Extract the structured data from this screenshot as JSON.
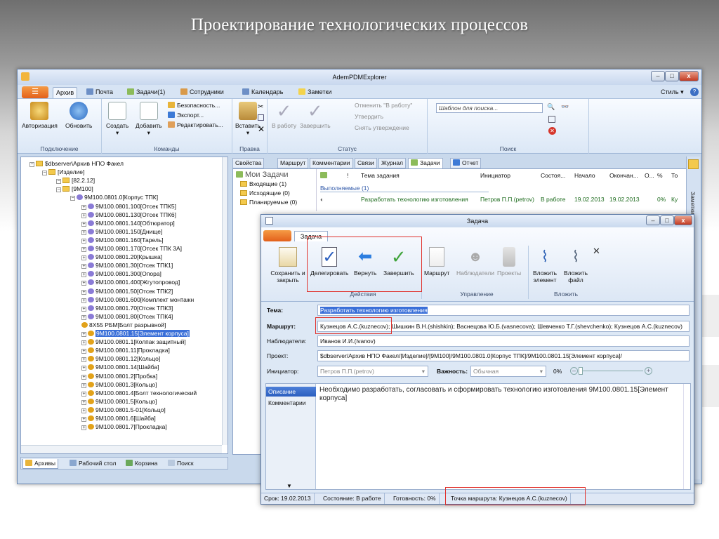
{
  "slide_title": "Проектирование технологических процессов",
  "main_window": {
    "title": "AdemPDMExplorer",
    "menu_tabs": [
      "Архив",
      "Почта",
      "Задачи(1)",
      "Сотрудники",
      "Календарь",
      "Заметки"
    ],
    "style_label": "Стиль",
    "ribbon": {
      "connection": {
        "label": "Подключение",
        "authorize": "Авторизация",
        "refresh": "Обновить"
      },
      "commands": {
        "label": "Команды",
        "create": "Создать",
        "add": "Добавить",
        "security": "Безопасность...",
        "export": "Экспорт...",
        "edit": "Редактировать..."
      },
      "edit": {
        "label": "Правка",
        "paste": "Вставить"
      },
      "status": {
        "label": "Статус",
        "to_work": "В работу",
        "finish": "Завершить",
        "cancel_work": "Отменить \"В работу\"",
        "approve": "Утвердить",
        "remove_approval": "Снять утверждение"
      },
      "search": {
        "label": "Поиск",
        "placeholder": "Шаблон для поиска..."
      }
    }
  },
  "tree": {
    "rows": [
      "$dbserver\\Архив НПО Факел",
      "[Изделие]",
      "[82.2.12]",
      "[9М100]",
      "9М100.0801.0[Корпус ТПК]",
      "9М100.0801.100[Отсек ТПК5]",
      "9М100.0801.130[Отсек ТПК6]",
      "9М100.0801.140[Обтюратор]",
      "9М100.0801.150[Днище]",
      "9М100.0801.160[Тарель]",
      "9М100.0801.170[Отсек ТПК 3А]",
      "9М100.0801.20[Крышка]",
      "9М100.0801.30[Отсек ТПК1]",
      "9М100.0801.300[Опора]",
      "9М100.0801.400[Жгутопровод]",
      "9М100.0801.50[Отсек ТПК2]",
      "9М100.0801.600[Комплект монтажн",
      "9М100.0801.70[Отсек ТПК3]",
      "9М100.0801.80[Отсек ТПК4]",
      "8Х55 РБМ[Болт разрывной]",
      "9М100.0801.15[Элемент корпуса]",
      "9М100.0801.1[Колпак защитный]",
      "9М100.0801.11[Прокладка]",
      "9М100.0801.12[Кольцо]",
      "9М100.0801.14[Шайба]",
      "9М100.0801.2[Пробка]",
      "9М100.0801.3[Кольцо]",
      "9М100.0801.4[Болт технологический",
      "9М100.0801.5[Кольцо]",
      "9М100.0801.5-01[Кольцо]",
      "9М100.0801.6[Шайба]",
      "9М100.0801.7[Прокладка]"
    ]
  },
  "bottom_tabs": [
    "Архивы",
    "Рабочий стол",
    "Корзина",
    "Поиск"
  ],
  "doc_tabs": [
    "Свойства",
    "Маршрут",
    "Комментарии",
    "Связи",
    "Журнал",
    "Задачи",
    "Отчет"
  ],
  "my_tasks": {
    "header": "Мои Задачи",
    "items": [
      "Входящие (1)",
      "Исходящие (0)",
      "Планируемые (0)"
    ]
  },
  "task_table": {
    "columns": [
      "!",
      "Тема задания",
      "Инициатор",
      "Состоя...",
      "Начало",
      "Окончан...",
      "О...",
      "%",
      "То"
    ],
    "group": "Выполняемые (1)",
    "row": {
      "subject": "Разработать технологию изготовления",
      "initiator": "Петров П.П.(petrov)",
      "state": "В работе",
      "start": "19.02.2013",
      "end": "19.02.2013",
      "percent": "0%",
      "to": "Ку"
    }
  },
  "side_strip_label": "Заметки на п",
  "task_dialog": {
    "title": "Задача",
    "tab": "Задача",
    "buttons": {
      "save_close": "Сохранить и закрыть",
      "delegate": "Делегировать",
      "return": "Вернуть",
      "finish": "Завершить",
      "route": "Маршрут",
      "observers": "Наблюдатели",
      "projects": "Проекты",
      "attach_element": "Вложить элемент",
      "attach_file": "Вложить файл"
    },
    "groups": {
      "actions": "Действия",
      "management": "Управление",
      "attach": "Вложить"
    },
    "fields": {
      "subject_label": "Тема:",
      "subject_value": "Разработать технологию изготовления",
      "route_label": "Маршрут:",
      "route_value": "Кузнецов А.С.(kuznecov); Шишкин В.Н.(shishkin); Васнецова Ю.Б.(vasnecova); Шевченко Т.Г.(shevchenko); Кузнецов А.С.(kuznecov)",
      "observers_label": "Наблюдатели:",
      "observers_value": "Иванов И.И.(ivanov)",
      "project_label": "Проект:",
      "project_value": "$dbserver/Архив НПО Факел/[Изделие]/[9М100]/9М100.0801.0[Корпус ТПК]/9М100.0801.15[Элемент корпуса]/",
      "initiator_label": "Инициатор:",
      "initiator_value": "Петров П.П.(petrov)",
      "importance_label": "Важность:",
      "importance_value": "Обычная",
      "percent_value": "0%"
    },
    "desc_tabs": [
      "Описание",
      "Комментарии"
    ],
    "description": "Необходимо разработать, согласовать и сформировать технологию изготовления 9М100.0801.15[Элемент корпуса]",
    "status_bar": [
      "Срок: 19.02.2013",
      "Состояние: В работе",
      "Готовность: 0%",
      "Точка маршрута: Кузнецов А.С.(kuznecov)"
    ]
  }
}
